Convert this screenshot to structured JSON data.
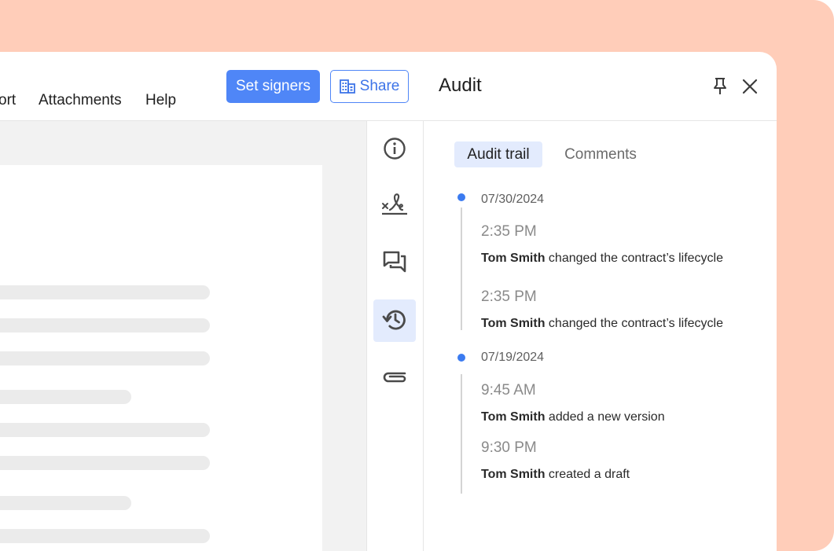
{
  "menu": {
    "items": [
      {
        "label": "ort"
      },
      {
        "label": "Attachments"
      },
      {
        "label": "Help"
      }
    ]
  },
  "toolbar": {
    "set_signers_label": "Set signers",
    "share_label": "Share"
  },
  "panel": {
    "title": "Audit",
    "tabs": [
      {
        "label": "Audit trail",
        "active": true
      },
      {
        "label": "Comments",
        "active": false
      }
    ]
  },
  "rail": {
    "icons": [
      "info-icon",
      "signature-icon",
      "comments-icon",
      "history-icon",
      "attachment-icon"
    ],
    "active": "history-icon"
  },
  "audit": {
    "groups": [
      {
        "date": "07/30/2024",
        "entries": [
          {
            "time": "2:35 PM",
            "user": "Tom Smith",
            "action": " changed the contract’s lifecycle"
          },
          {
            "time": "2:35 PM",
            "user": "Tom Smith",
            "action": " changed the contract’s lifecycle"
          }
        ]
      },
      {
        "date": "07/19/2024",
        "entries": [
          {
            "time": "9:45 AM",
            "user": "Tom Smith",
            "action": " added a new version"
          },
          {
            "time": "9:30 PM",
            "user": "Tom Smith",
            "action": " created a draft"
          }
        ]
      }
    ]
  },
  "colors": {
    "accent": "#4f86f7",
    "backdrop": "#ffcdb9",
    "active_tab_bg": "#e3ebfd",
    "timeline_dot": "#3b7bf0"
  }
}
